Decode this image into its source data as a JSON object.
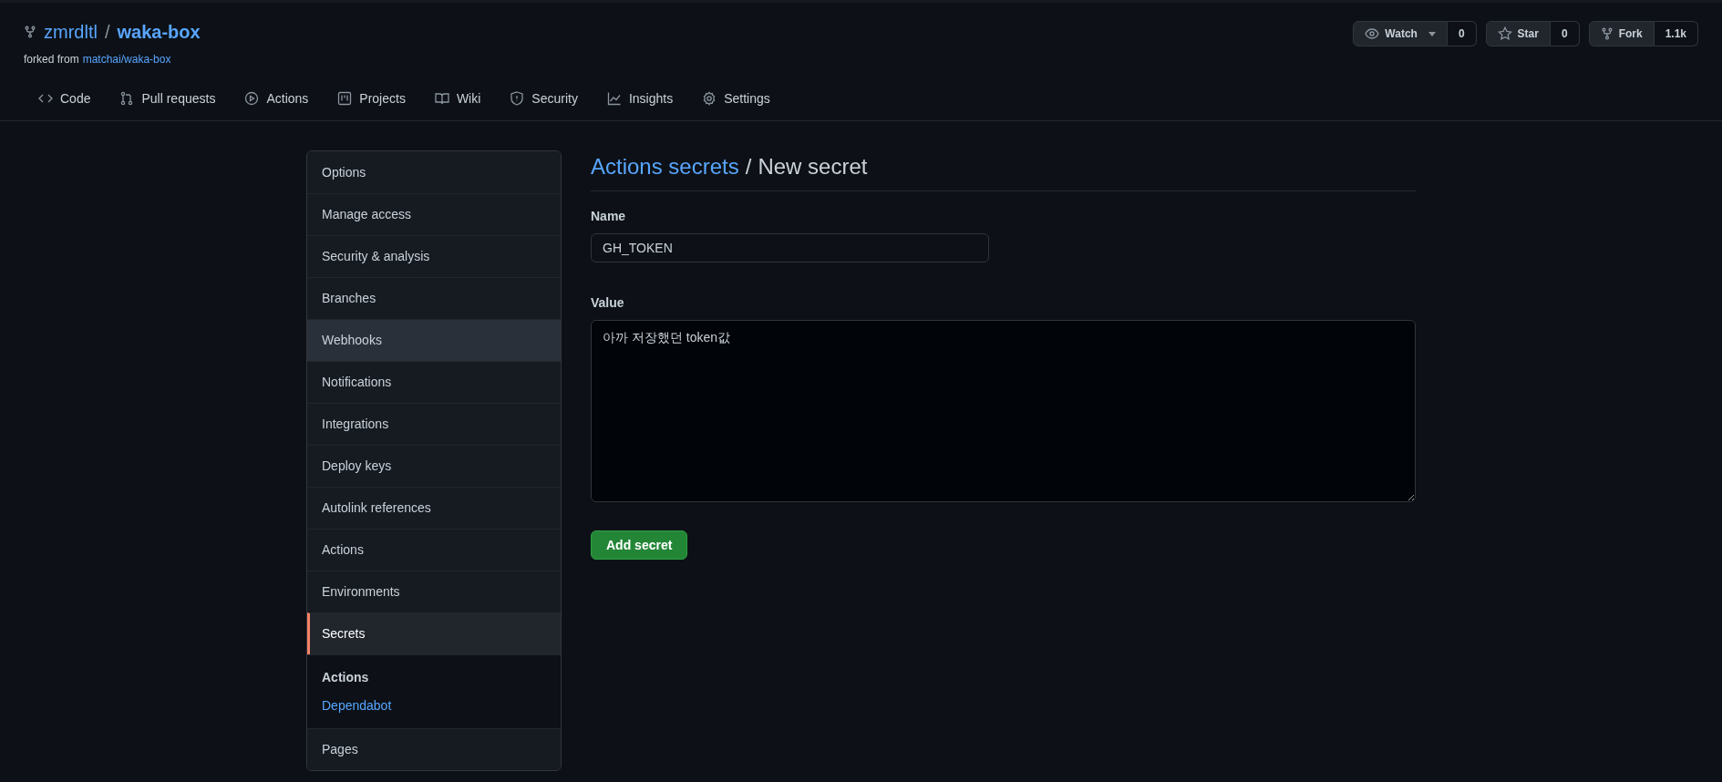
{
  "repo": {
    "owner": "zmrdltl",
    "separator": "/",
    "name": "waka-box",
    "forked_from_label": "forked from",
    "forked_from": "matchai/waka-box"
  },
  "repo_actions": [
    {
      "kind": "watch",
      "label": "Watch",
      "count": "0"
    },
    {
      "kind": "star",
      "label": "Star",
      "count": "0"
    },
    {
      "kind": "fork",
      "label": "Fork",
      "count": "1.1k"
    }
  ],
  "tabs": [
    {
      "kind": "code",
      "label": "Code",
      "selected": false
    },
    {
      "kind": "pull",
      "label": "Pull requests",
      "selected": false
    },
    {
      "kind": "actions",
      "label": "Actions",
      "selected": false
    },
    {
      "kind": "projects",
      "label": "Projects",
      "selected": false
    },
    {
      "kind": "wiki",
      "label": "Wiki",
      "selected": false
    },
    {
      "kind": "security",
      "label": "Security",
      "selected": false
    },
    {
      "kind": "insights",
      "label": "Insights",
      "selected": false
    },
    {
      "kind": "settings",
      "label": "Settings",
      "selected": false
    }
  ],
  "sidebar": {
    "items": [
      {
        "label": "Options",
        "selected": false,
        "hovered": false
      },
      {
        "label": "Manage access",
        "selected": false,
        "hovered": false
      },
      {
        "label": "Security & analysis",
        "selected": false,
        "hovered": false
      },
      {
        "label": "Branches",
        "selected": false,
        "hovered": false
      },
      {
        "label": "Webhooks",
        "selected": false,
        "hovered": true
      },
      {
        "label": "Notifications",
        "selected": false,
        "hovered": false
      },
      {
        "label": "Integrations",
        "selected": false,
        "hovered": false
      },
      {
        "label": "Deploy keys",
        "selected": false,
        "hovered": false
      },
      {
        "label": "Autolink references",
        "selected": false,
        "hovered": false
      },
      {
        "label": "Actions",
        "selected": false,
        "hovered": false
      },
      {
        "label": "Environments",
        "selected": false,
        "hovered": false
      },
      {
        "label": "Secrets",
        "selected": true,
        "hovered": false,
        "children": [
          {
            "label": "Actions",
            "selected": true
          },
          {
            "label": "Dependabot",
            "selected": false
          }
        ]
      },
      {
        "label": "Pages",
        "selected": false,
        "hovered": false
      }
    ]
  },
  "form": {
    "breadcrumb_link": "Actions secrets",
    "breadcrumb_separator": "/",
    "title": "New secret",
    "name_label": "Name",
    "name_value": "GH_TOKEN",
    "value_label": "Value",
    "value_value": "아까 저장했던 token값",
    "submit": "Add secret"
  }
}
